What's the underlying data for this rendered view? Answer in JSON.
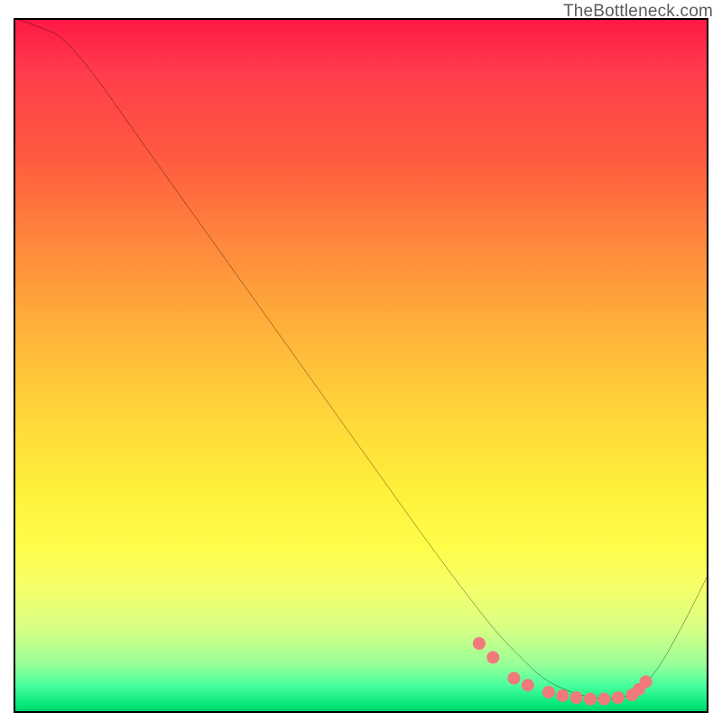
{
  "watermark": "TheBottleneck.com",
  "chart_data": {
    "type": "line",
    "title": "",
    "xlabel": "",
    "ylabel": "",
    "xlim": [
      0,
      100
    ],
    "ylim": [
      0,
      100
    ],
    "grid": false,
    "background_gradient": {
      "orientation": "vertical",
      "stops": [
        {
          "pos": 0.0,
          "color": "#ff1744"
        },
        {
          "pos": 0.2,
          "color": "#ff5a3f"
        },
        {
          "pos": 0.46,
          "color": "#ffb53a"
        },
        {
          "pos": 0.68,
          "color": "#fff03a"
        },
        {
          "pos": 0.88,
          "color": "#d6ff85"
        },
        {
          "pos": 1.0,
          "color": "#00c866"
        }
      ]
    },
    "series": [
      {
        "name": "bottleneck-curve",
        "color": "#000000",
        "x": [
          0,
          3,
          8,
          20,
          30,
          40,
          50,
          60,
          66,
          70,
          73,
          76,
          80,
          84,
          88,
          92,
          96,
          100
        ],
        "y": [
          100,
          99,
          97,
          80,
          66,
          52,
          38,
          24,
          16,
          11,
          8,
          5,
          3,
          2,
          2,
          5,
          12,
          20
        ]
      }
    ],
    "markers": {
      "name": "highlight-dots",
      "color": "#f07a7a",
      "radius": 7,
      "x": [
        67,
        69,
        72,
        74,
        77,
        79,
        81,
        83,
        85,
        87,
        89,
        90,
        91
      ],
      "y": [
        10,
        8,
        5,
        4,
        3,
        2.5,
        2.2,
        2,
        2,
        2.2,
        2.6,
        3.4,
        4.5
      ]
    }
  }
}
